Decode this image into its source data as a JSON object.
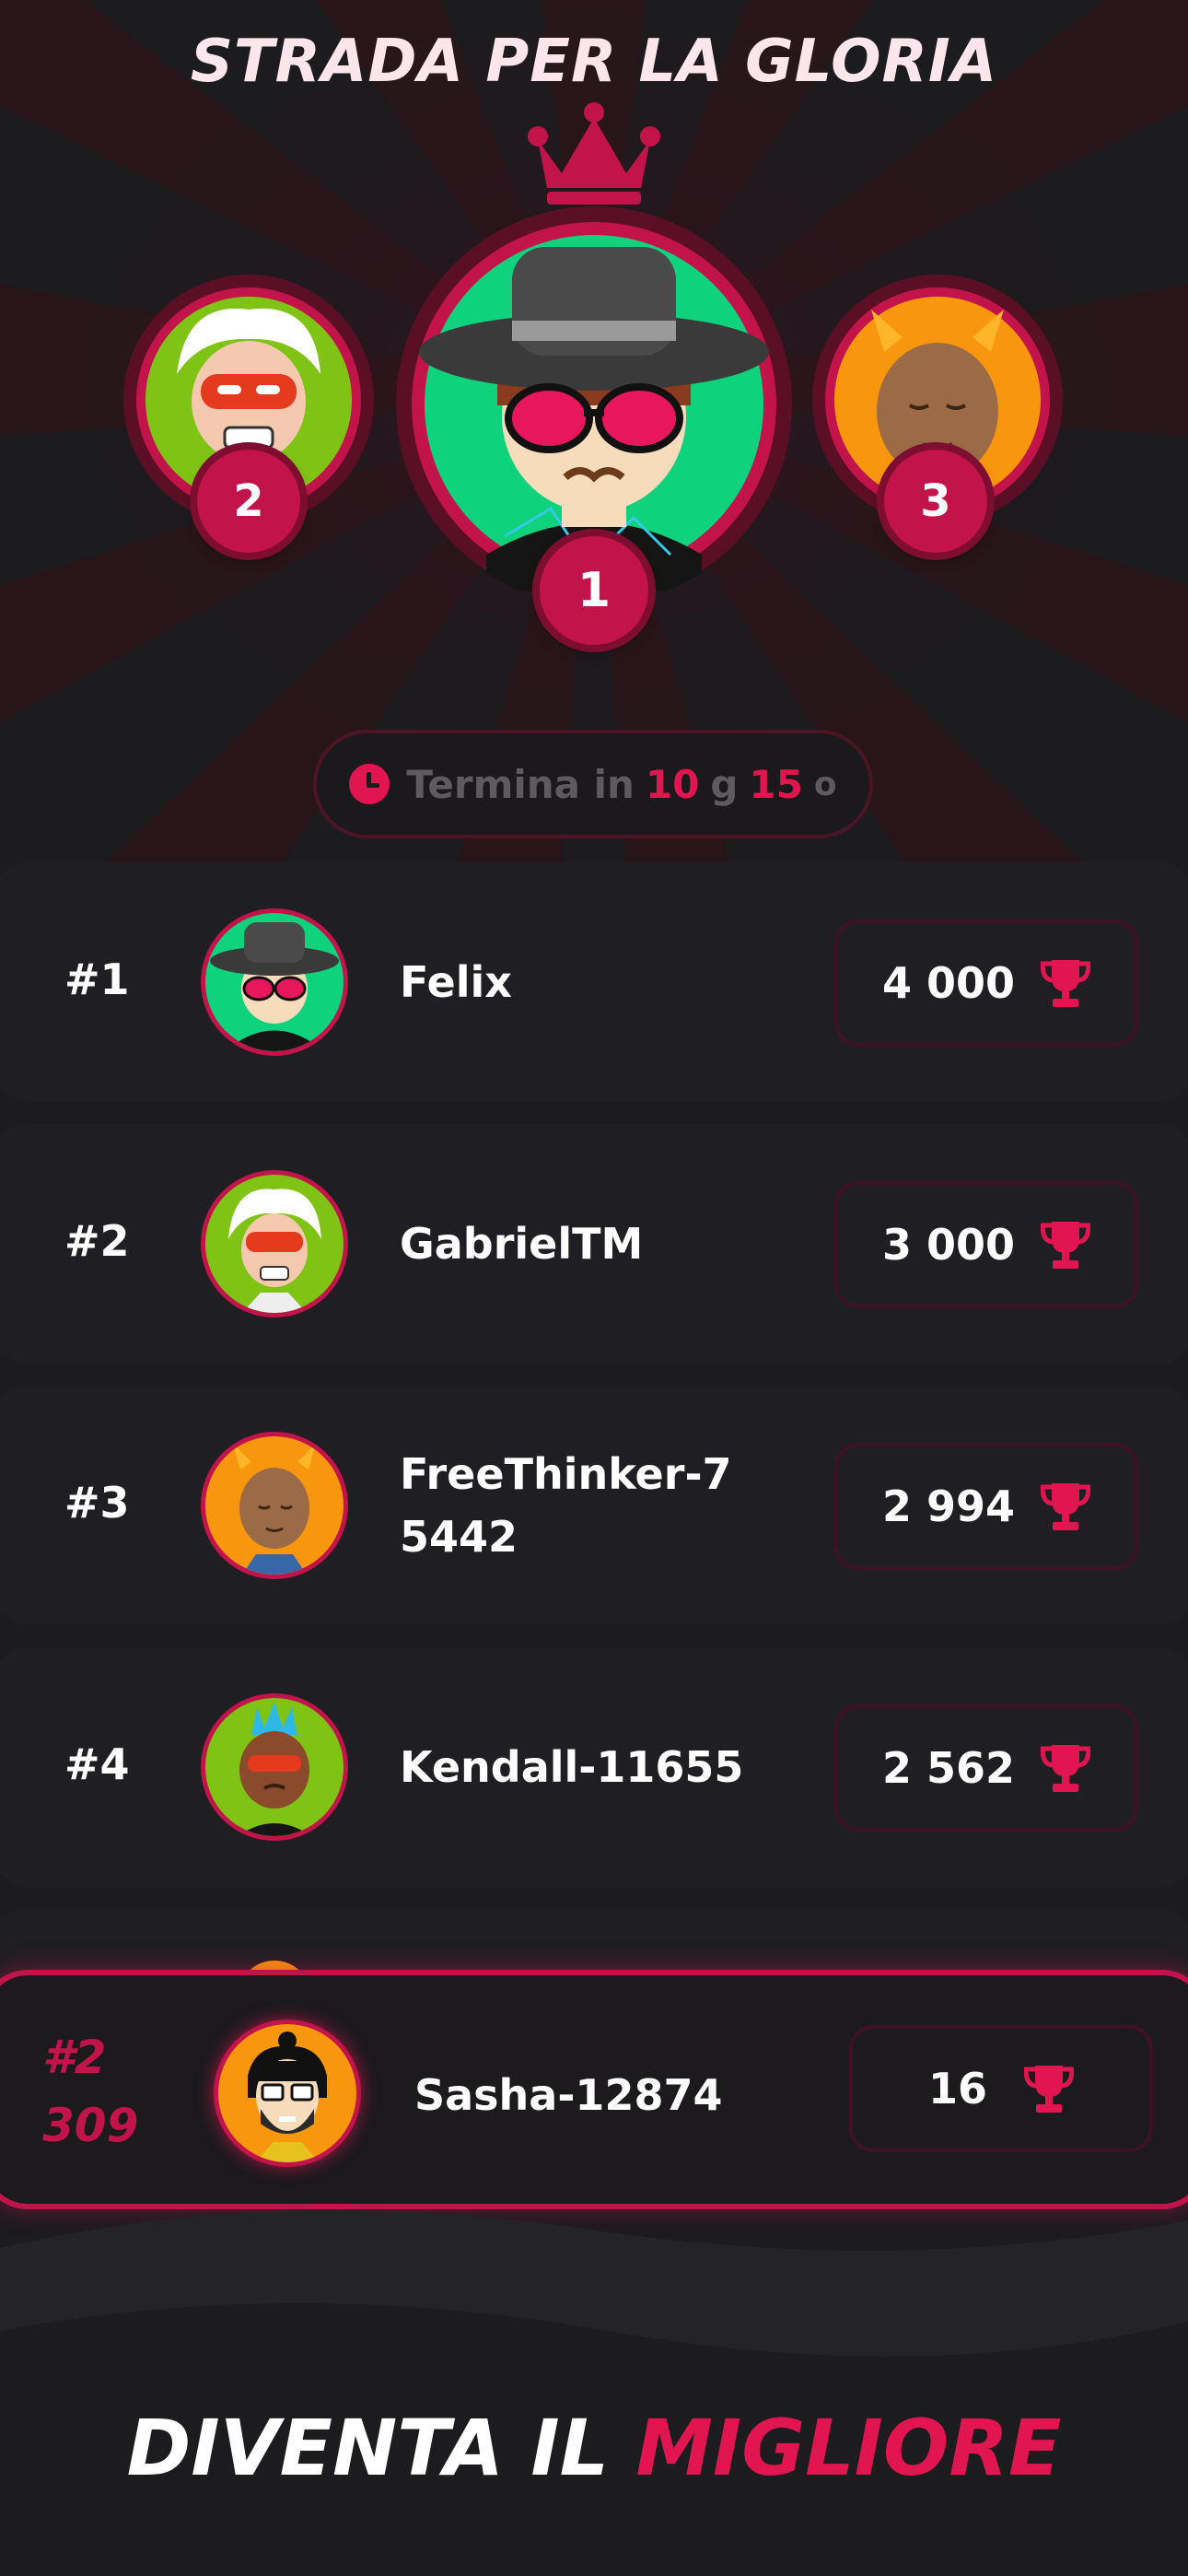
{
  "header": {
    "title": "STRADA PER LA GLORIA"
  },
  "podium": [
    {
      "position": "1",
      "avatar_icon": "fedora-sunglasses-avatar-icon"
    },
    {
      "position": "2",
      "avatar_icon": "white-hair-mask-avatar-icon"
    },
    {
      "position": "3",
      "avatar_icon": "orange-horns-avatar-icon"
    }
  ],
  "timer": {
    "label": "Termina in",
    "days": "10",
    "days_unit": "g",
    "hours": "15",
    "hours_unit": "o"
  },
  "leaderboard": [
    {
      "rank": "#1",
      "name": "Felix",
      "score": "4 000"
    },
    {
      "rank": "#2",
      "name": "GabrielTM",
      "score": "3 000"
    },
    {
      "rank": "#3",
      "name_line1": "FreeThinker-7",
      "name_line2": "5442",
      "score": "2 994"
    },
    {
      "rank": "#4",
      "name": "Kendall-11655",
      "score": "2 562"
    }
  ],
  "current_user": {
    "rank_line1": "#2",
    "rank_line2": "309",
    "name": "Sasha-12874",
    "score": "16"
  },
  "cta": {
    "prefix": "DIVENTA IL ",
    "highlight": "MIGLIORE"
  },
  "colors": {
    "accent": "#e1154f",
    "badge": "#c2134b",
    "background": "#1c1b1e",
    "row": "#1f1e22"
  }
}
